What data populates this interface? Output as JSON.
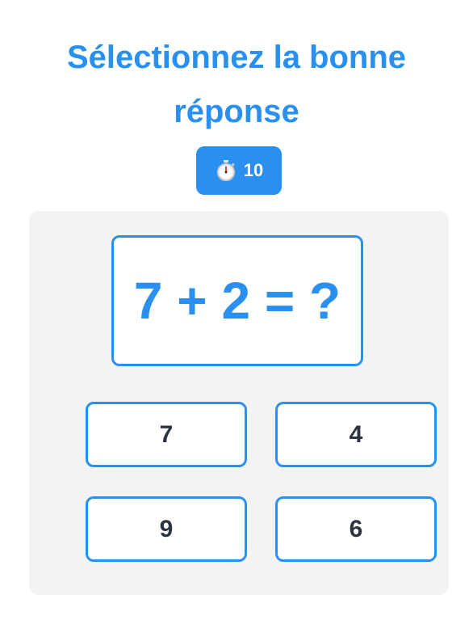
{
  "title": "Sélectionnez la bonne réponse",
  "timer": {
    "icon": "stopwatch-icon",
    "value": "10"
  },
  "question": {
    "text": "7 + 2 = ?"
  },
  "answers": [
    {
      "label": "7"
    },
    {
      "label": "4"
    },
    {
      "label": "9"
    },
    {
      "label": "6"
    }
  ],
  "colors": {
    "accent": "#2a90f0",
    "panel": "#f3f3f3",
    "answer_text": "#2c3440"
  }
}
